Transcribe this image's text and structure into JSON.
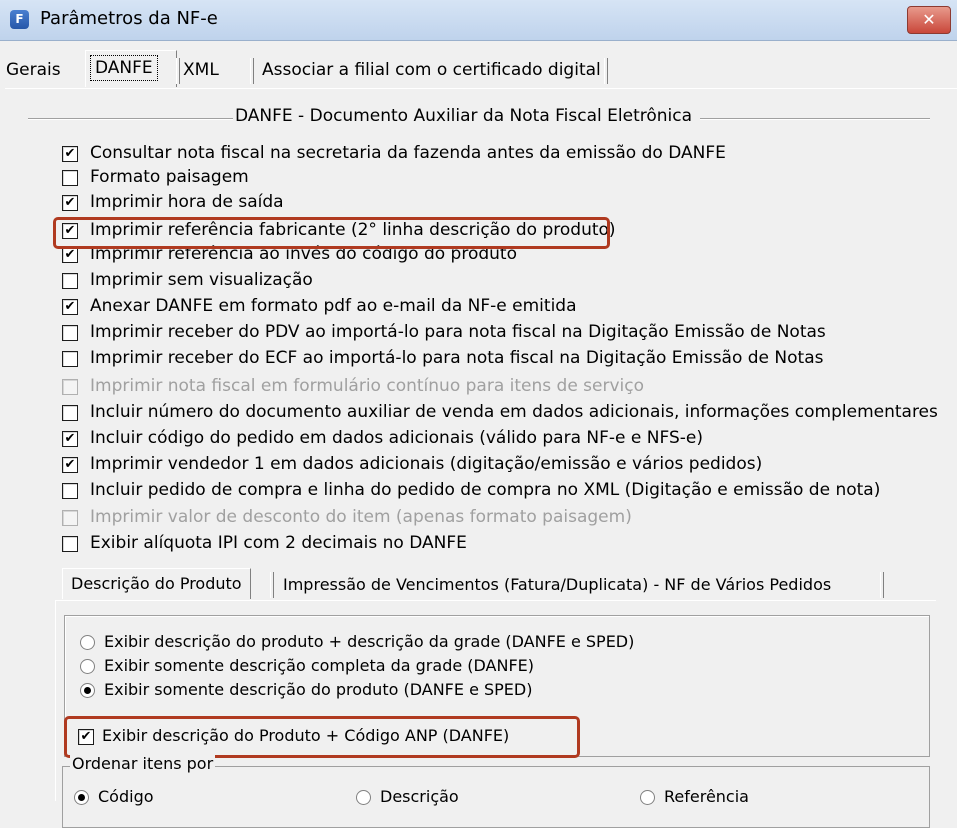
{
  "window": {
    "title": "Parâmetros da NF-e",
    "icon_letter": "F",
    "close_glyph": "✕"
  },
  "tabs": [
    "Gerais",
    "DANFE",
    "XML",
    "Associar a filial com o certificado digital"
  ],
  "group_title": "DANFE - Documento Auxiliar da Nota Fiscal Eletrônica",
  "options": [
    {
      "label": "Consultar nota fiscal na secretaria da fazenda antes da emissão do DANFE",
      "checked": true
    },
    {
      "label": "Formato paisagem",
      "checked": false
    },
    {
      "label": "Imprimir hora de saída",
      "checked": true
    },
    {
      "label": "Imprimir referência fabricante (2° linha descrição do produto)",
      "checked": true
    },
    {
      "label": "Imprimir referência ao invés do código do produto",
      "checked": true
    },
    {
      "label": "Imprimir sem visualização",
      "checked": false
    },
    {
      "label": "Anexar DANFE em formato pdf ao e-mail da NF-e emitida",
      "checked": true
    },
    {
      "label": "Imprimir receber do PDV ao importá-lo para nota fiscal na Digitação Emissão de Notas",
      "checked": false
    },
    {
      "label": "Imprimir receber do ECF ao importá-lo para nota fiscal na Digitação Emissão de Notas",
      "checked": false
    },
    {
      "label": "Imprimir nota fiscal em formulário contínuo para itens de serviço",
      "checked": false,
      "disabled": true
    },
    {
      "label": "Incluir número do documento auxiliar de venda em dados adicionais, informações complementares",
      "checked": false
    },
    {
      "label": "Incluir código do pedido em dados adicionais (válido para NF-e e NFS-e)",
      "checked": true
    },
    {
      "label": "Imprimir vendedor 1 em dados adicionais (digitação/emissão e vários pedidos)",
      "checked": true
    },
    {
      "label": "Incluir pedido de compra e linha do pedido de compra no XML (Digitação e emissão de nota)",
      "checked": false
    },
    {
      "label": "Imprimir valor de desconto do item (apenas formato paisagem)",
      "checked": false,
      "disabled": true
    },
    {
      "label": "Exibir alíquota IPI com 2 decimais no DANFE",
      "checked": false
    }
  ],
  "inner_tabs": [
    "Descrição do Produto",
    "Impressão de Vencimentos (Fatura/Duplicata) - NF de Vários Pedidos"
  ],
  "description_options": [
    {
      "label": "Exibir descrição do produto + descrição da grade (DANFE e SPED)",
      "selected": false
    },
    {
      "label": "Exibir somente descrição completa da grade (DANFE)",
      "selected": false
    },
    {
      "label": "Exibir somente descrição do produto (DANFE e SPED)",
      "selected": true
    }
  ],
  "anp_option": {
    "label": "Exibir descrição do Produto + Código ANP (DANFE)",
    "checked": true
  },
  "order": {
    "legend": "Ordenar itens por",
    "options": [
      {
        "label": "Código",
        "selected": true
      },
      {
        "label": "Descrição",
        "selected": false
      },
      {
        "label": "Referência",
        "selected": false
      }
    ]
  },
  "check_glyph": "✔",
  "colors": {
    "highlight": "#b03a20",
    "disabled_text": "#a0a0a0"
  }
}
